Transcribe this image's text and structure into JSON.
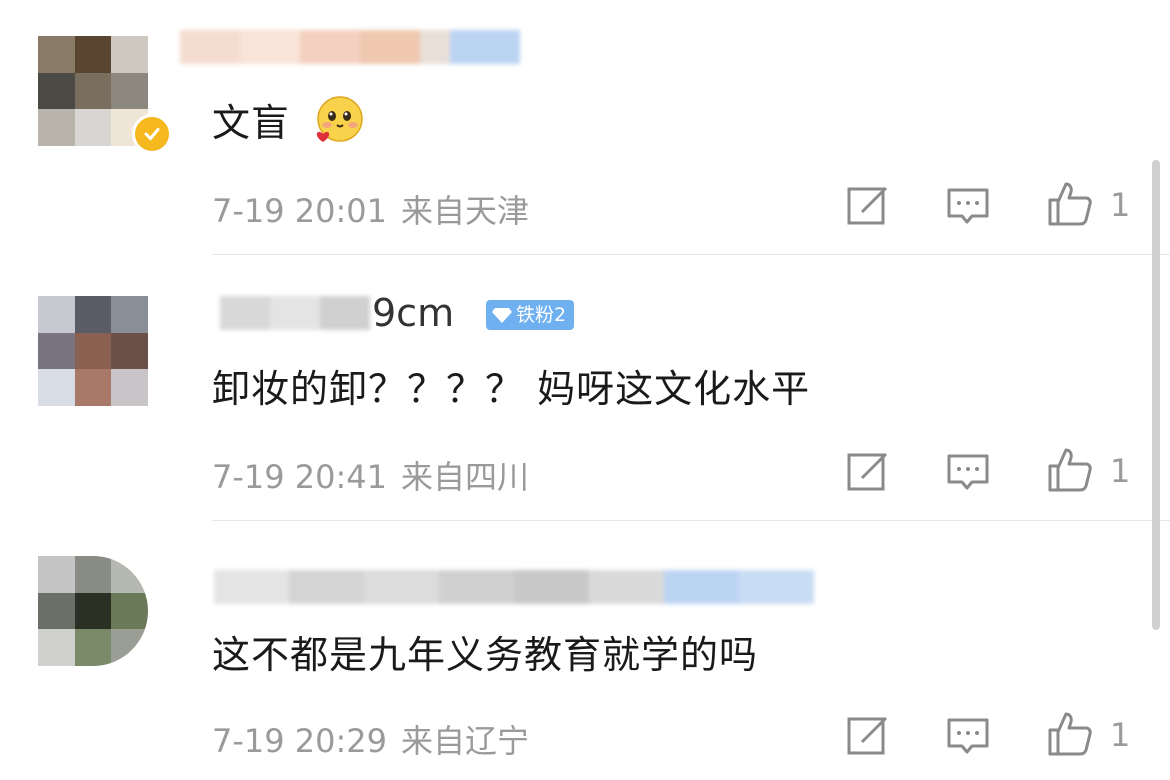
{
  "comments": [
    {
      "text": "文盲",
      "emoji": "flushed-heart-emoji",
      "time": "7-19 20:01",
      "location": "来自天津",
      "likes": "1",
      "badge": "",
      "verified": true
    },
    {
      "username_partial": "9cm",
      "text": "卸妆的卸？？？？ 妈呀这文化水平",
      "time": "7-19 20:41",
      "location": "来自四川",
      "likes": "1",
      "badge": "铁粉2"
    },
    {
      "text": "这不都是九年义务教育就学的吗",
      "time": "7-19 20:29",
      "location": "来自辽宁",
      "likes": "1",
      "badge": ""
    }
  ],
  "icons": {
    "reply": "edit-square-icon",
    "comment": "comment-bubble-icon",
    "like": "thumbs-up-icon",
    "badge_gem": "diamond-icon"
  },
  "colors": {
    "text": "#1a1a1a",
    "meta": "#9a9a9a",
    "badge": "#6fb0f0",
    "divider": "#e6e6e6"
  }
}
